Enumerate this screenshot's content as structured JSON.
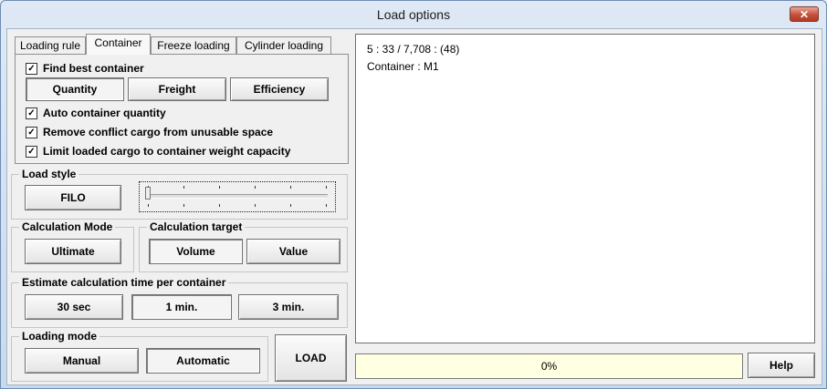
{
  "window": {
    "title": "Load options",
    "close_glyph": "✕"
  },
  "tabs": [
    {
      "label": "Loading rule",
      "active": false
    },
    {
      "label": "Container",
      "active": true
    },
    {
      "label": "Freeze loading",
      "active": false
    },
    {
      "label": "Cylinder loading",
      "active": false
    }
  ],
  "container_tab": {
    "find_best": {
      "label": "Find best container",
      "checked": true
    },
    "modes": [
      "Quantity",
      "Freight",
      "Efficiency"
    ],
    "selected_mode": "Quantity",
    "auto_qty": {
      "label": "Auto container quantity",
      "checked": true
    },
    "remove_conflict": {
      "label": "Remove conflict cargo from unusable space",
      "checked": true
    },
    "limit_weight": {
      "label": "Limit loaded cargo to container weight capacity",
      "checked": true
    }
  },
  "load_style": {
    "legend": "Load style",
    "button": "FILO",
    "slider_value": 0,
    "slider_ticks": 6
  },
  "calc_mode": {
    "legend": "Calculation Mode",
    "button": "Ultimate"
  },
  "calc_target": {
    "legend": "Calculation target",
    "options": [
      "Volume",
      "Value"
    ],
    "selected": "Volume"
  },
  "estimate": {
    "legend": "Estimate calculation time per container",
    "options": [
      "30 sec",
      "1 min.",
      "3 min."
    ],
    "selected": "1 min."
  },
  "loading_mode": {
    "legend": "Loading mode",
    "options": [
      "Manual",
      "Automatic"
    ],
    "selected": "Automatic"
  },
  "load_button": "LOAD",
  "output": {
    "line1": "5 : 33 / 7,708 : (48)",
    "line2": "Container : M1"
  },
  "progress": {
    "text": "0%",
    "value": 0
  },
  "help_button": "Help",
  "check_glyph": "✓"
}
